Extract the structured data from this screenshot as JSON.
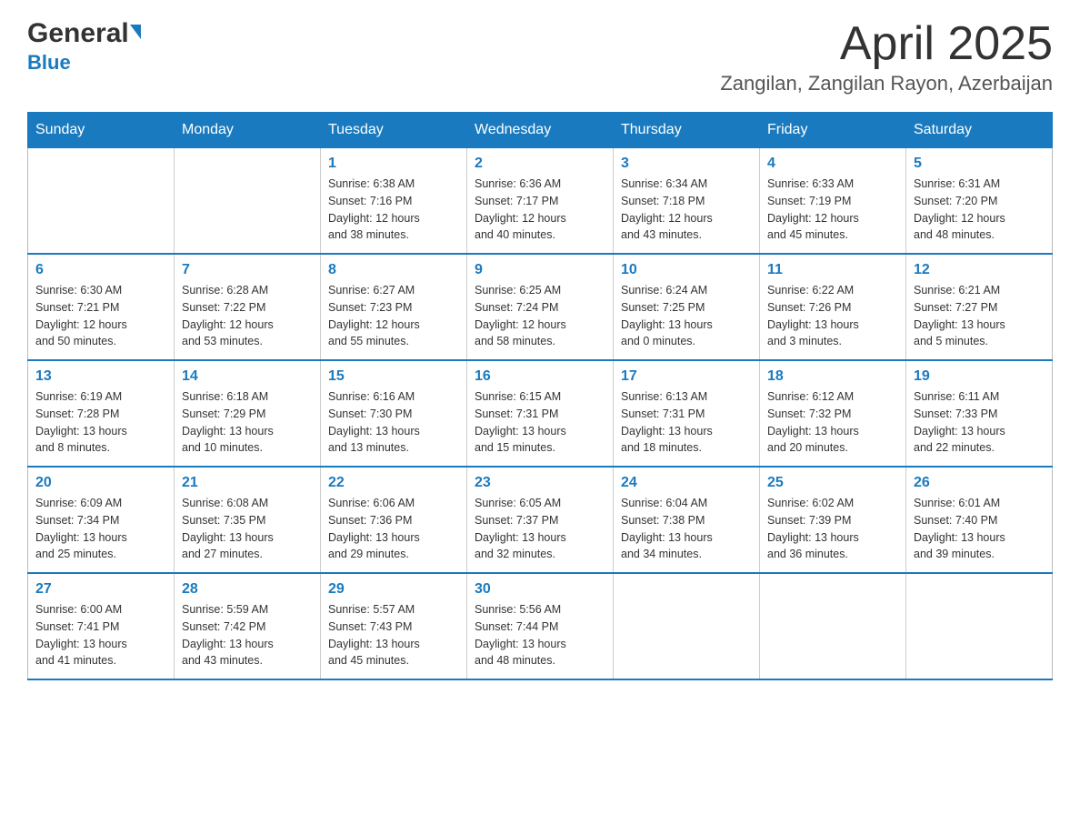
{
  "header": {
    "logo_general": "General",
    "logo_blue": "Blue",
    "title": "April 2025",
    "subtitle": "Zangilan, Zangilan Rayon, Azerbaijan"
  },
  "weekdays": [
    "Sunday",
    "Monday",
    "Tuesday",
    "Wednesday",
    "Thursday",
    "Friday",
    "Saturday"
  ],
  "weeks": [
    [
      {
        "day": "",
        "info": ""
      },
      {
        "day": "",
        "info": ""
      },
      {
        "day": "1",
        "info": "Sunrise: 6:38 AM\nSunset: 7:16 PM\nDaylight: 12 hours\nand 38 minutes."
      },
      {
        "day": "2",
        "info": "Sunrise: 6:36 AM\nSunset: 7:17 PM\nDaylight: 12 hours\nand 40 minutes."
      },
      {
        "day": "3",
        "info": "Sunrise: 6:34 AM\nSunset: 7:18 PM\nDaylight: 12 hours\nand 43 minutes."
      },
      {
        "day": "4",
        "info": "Sunrise: 6:33 AM\nSunset: 7:19 PM\nDaylight: 12 hours\nand 45 minutes."
      },
      {
        "day": "5",
        "info": "Sunrise: 6:31 AM\nSunset: 7:20 PM\nDaylight: 12 hours\nand 48 minutes."
      }
    ],
    [
      {
        "day": "6",
        "info": "Sunrise: 6:30 AM\nSunset: 7:21 PM\nDaylight: 12 hours\nand 50 minutes."
      },
      {
        "day": "7",
        "info": "Sunrise: 6:28 AM\nSunset: 7:22 PM\nDaylight: 12 hours\nand 53 minutes."
      },
      {
        "day": "8",
        "info": "Sunrise: 6:27 AM\nSunset: 7:23 PM\nDaylight: 12 hours\nand 55 minutes."
      },
      {
        "day": "9",
        "info": "Sunrise: 6:25 AM\nSunset: 7:24 PM\nDaylight: 12 hours\nand 58 minutes."
      },
      {
        "day": "10",
        "info": "Sunrise: 6:24 AM\nSunset: 7:25 PM\nDaylight: 13 hours\nand 0 minutes."
      },
      {
        "day": "11",
        "info": "Sunrise: 6:22 AM\nSunset: 7:26 PM\nDaylight: 13 hours\nand 3 minutes."
      },
      {
        "day": "12",
        "info": "Sunrise: 6:21 AM\nSunset: 7:27 PM\nDaylight: 13 hours\nand 5 minutes."
      }
    ],
    [
      {
        "day": "13",
        "info": "Sunrise: 6:19 AM\nSunset: 7:28 PM\nDaylight: 13 hours\nand 8 minutes."
      },
      {
        "day": "14",
        "info": "Sunrise: 6:18 AM\nSunset: 7:29 PM\nDaylight: 13 hours\nand 10 minutes."
      },
      {
        "day": "15",
        "info": "Sunrise: 6:16 AM\nSunset: 7:30 PM\nDaylight: 13 hours\nand 13 minutes."
      },
      {
        "day": "16",
        "info": "Sunrise: 6:15 AM\nSunset: 7:31 PM\nDaylight: 13 hours\nand 15 minutes."
      },
      {
        "day": "17",
        "info": "Sunrise: 6:13 AM\nSunset: 7:31 PM\nDaylight: 13 hours\nand 18 minutes."
      },
      {
        "day": "18",
        "info": "Sunrise: 6:12 AM\nSunset: 7:32 PM\nDaylight: 13 hours\nand 20 minutes."
      },
      {
        "day": "19",
        "info": "Sunrise: 6:11 AM\nSunset: 7:33 PM\nDaylight: 13 hours\nand 22 minutes."
      }
    ],
    [
      {
        "day": "20",
        "info": "Sunrise: 6:09 AM\nSunset: 7:34 PM\nDaylight: 13 hours\nand 25 minutes."
      },
      {
        "day": "21",
        "info": "Sunrise: 6:08 AM\nSunset: 7:35 PM\nDaylight: 13 hours\nand 27 minutes."
      },
      {
        "day": "22",
        "info": "Sunrise: 6:06 AM\nSunset: 7:36 PM\nDaylight: 13 hours\nand 29 minutes."
      },
      {
        "day": "23",
        "info": "Sunrise: 6:05 AM\nSunset: 7:37 PM\nDaylight: 13 hours\nand 32 minutes."
      },
      {
        "day": "24",
        "info": "Sunrise: 6:04 AM\nSunset: 7:38 PM\nDaylight: 13 hours\nand 34 minutes."
      },
      {
        "day": "25",
        "info": "Sunrise: 6:02 AM\nSunset: 7:39 PM\nDaylight: 13 hours\nand 36 minutes."
      },
      {
        "day": "26",
        "info": "Sunrise: 6:01 AM\nSunset: 7:40 PM\nDaylight: 13 hours\nand 39 minutes."
      }
    ],
    [
      {
        "day": "27",
        "info": "Sunrise: 6:00 AM\nSunset: 7:41 PM\nDaylight: 13 hours\nand 41 minutes."
      },
      {
        "day": "28",
        "info": "Sunrise: 5:59 AM\nSunset: 7:42 PM\nDaylight: 13 hours\nand 43 minutes."
      },
      {
        "day": "29",
        "info": "Sunrise: 5:57 AM\nSunset: 7:43 PM\nDaylight: 13 hours\nand 45 minutes."
      },
      {
        "day": "30",
        "info": "Sunrise: 5:56 AM\nSunset: 7:44 PM\nDaylight: 13 hours\nand 48 minutes."
      },
      {
        "day": "",
        "info": ""
      },
      {
        "day": "",
        "info": ""
      },
      {
        "day": "",
        "info": ""
      }
    ]
  ]
}
